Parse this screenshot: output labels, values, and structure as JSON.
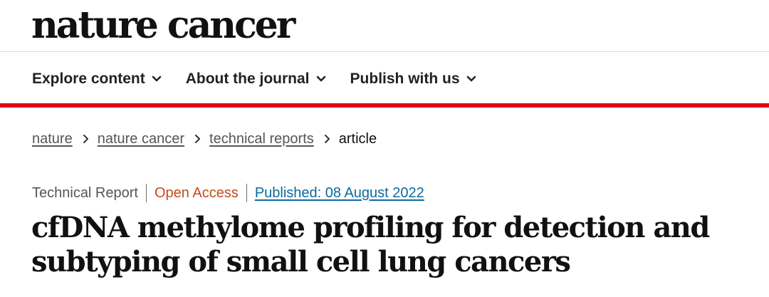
{
  "header": {
    "logo_text": "nature cancer"
  },
  "nav": {
    "items": [
      {
        "label": "Explore content"
      },
      {
        "label": "About the journal"
      },
      {
        "label": "Publish with us"
      }
    ]
  },
  "breadcrumb": {
    "items": [
      {
        "label": "nature"
      },
      {
        "label": "nature cancer"
      },
      {
        "label": "technical reports"
      }
    ],
    "current": "article"
  },
  "article": {
    "type": "Technical Report",
    "access": "Open Access",
    "published": "Published: 08 August 2022",
    "title": "cfDNA methylome profiling for detection and subtyping of small cell lung cancers"
  },
  "colors": {
    "brand_red": "#e2001a",
    "open_access": "#c4491a",
    "link_blue": "#0a6a9d"
  },
  "icons": {
    "nav_chevron": "chevron-down-icon",
    "breadcrumb_separator": "chevron-right-icon"
  }
}
